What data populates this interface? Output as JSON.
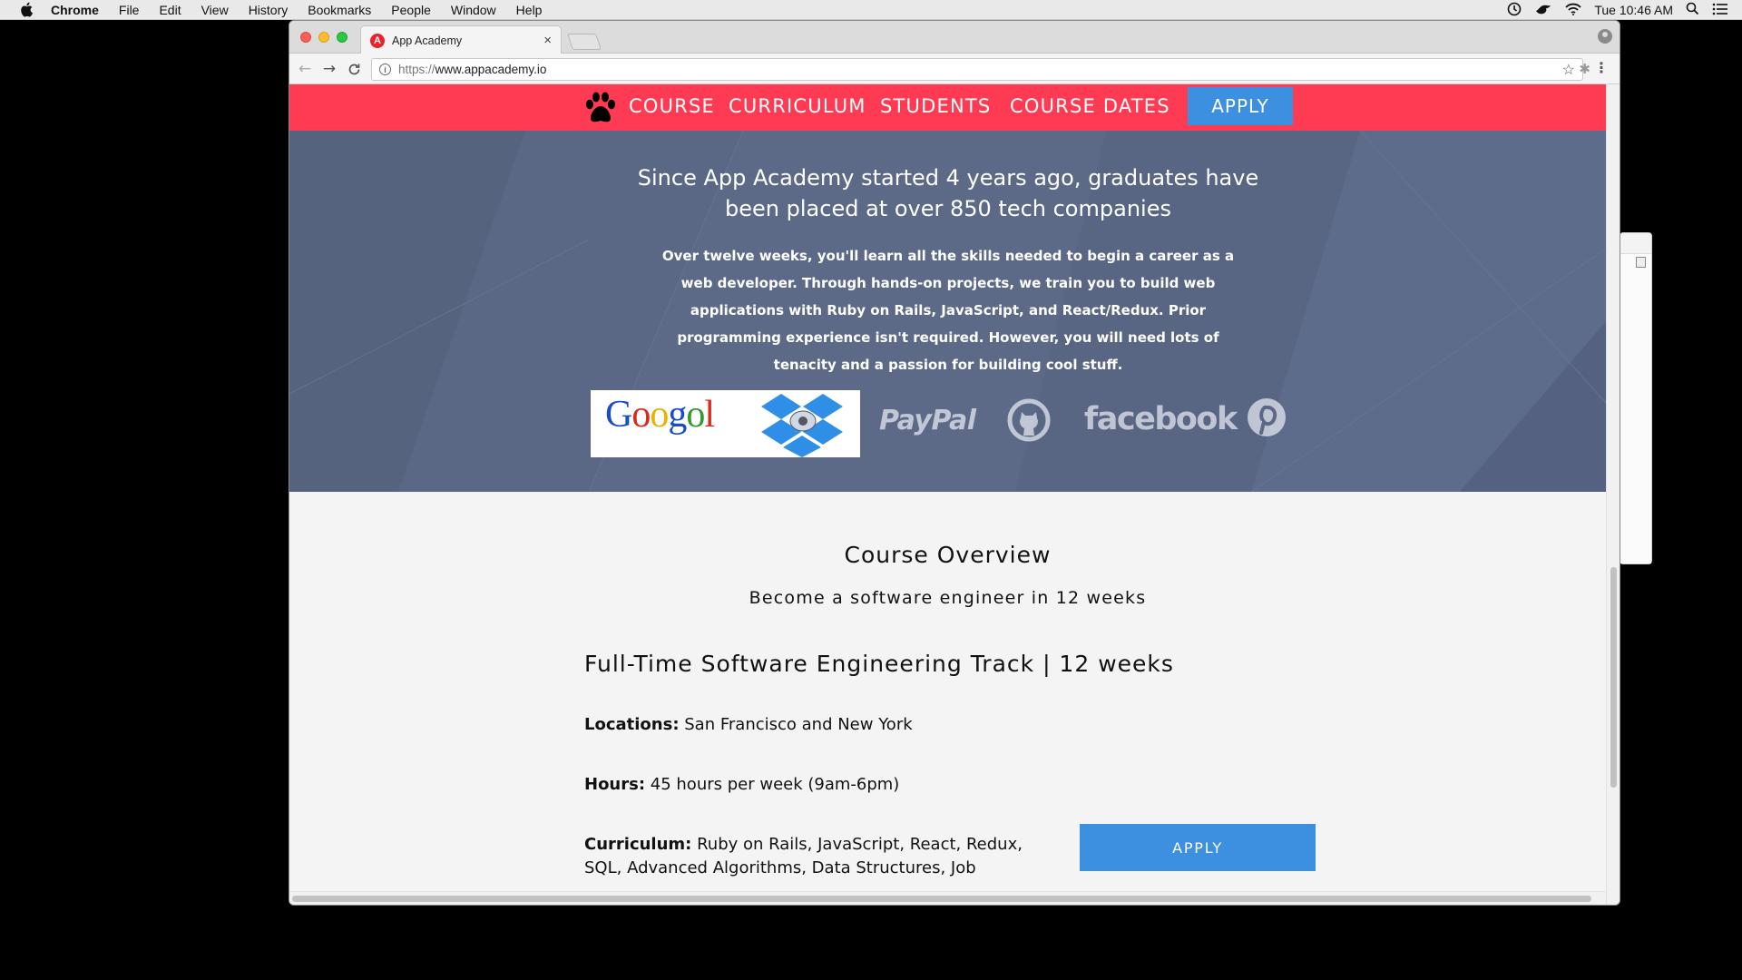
{
  "menubar": {
    "app_name": "Chrome",
    "items": [
      "File",
      "Edit",
      "View",
      "History",
      "Bookmarks",
      "People",
      "Window",
      "Help"
    ],
    "clock": "Tue 10:46 AM"
  },
  "browser": {
    "tab_title": "App Academy",
    "favicon_letter": "A",
    "url_scheme": "https://",
    "url_host": "www.appacademy.io"
  },
  "site_nav": {
    "links": [
      "COURSE",
      "CURRICULUM",
      "STUDENTS",
      "COURSE DATES"
    ],
    "apply": "APPLY"
  },
  "hero": {
    "heading": "Since App Academy started 4 years ago, graduates have been placed at over 850 tech companies",
    "paragraph": "Over twelve weeks, you'll learn all the skills needed to begin a career as a web developer. Through hands-on projects, we train you to build web applications with Ruby on Rails, JavaScript, and React/Redux. Prior programming experience isn't required. However, you will need lots of tenacity and a passion for building cool stuff.",
    "logos": {
      "googol": "Googol",
      "paypal": "PayPal",
      "facebook": "facebook",
      "github": "github-icon",
      "pinterest": "pinterest-icon"
    }
  },
  "overview": {
    "title": "Course Overview",
    "subtitle": "Become a software engineer in 12 weeks",
    "track_title": "Full-Time Software Engineering Track | 12 weeks",
    "locations_label": "Locations:",
    "locations_value": " San Francisco and New York",
    "hours_label": "Hours:",
    "hours_value": " 45 hours per week (9am-6pm)",
    "curriculum_label": "Curriculum:",
    "curriculum_value_line1": " Ruby on Rails, JavaScript, React, Redux,",
    "curriculum_value_line2": "SQL, Advanced Algorithms, Data Structures, Job",
    "apply": "APPLY"
  },
  "colors": {
    "nav_red": "#ff3b53",
    "hero_slate": "#5c6a88",
    "apply_blue": "#3d8fe0"
  }
}
